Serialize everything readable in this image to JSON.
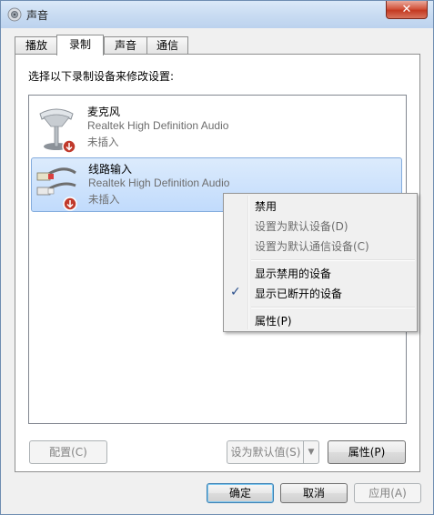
{
  "window": {
    "title": "声音",
    "close_icon": "close-icon"
  },
  "tabs": [
    {
      "label": "播放"
    },
    {
      "label": "录制"
    },
    {
      "label": "声音"
    },
    {
      "label": "通信"
    }
  ],
  "panel": {
    "instruction": "选择以下录制设备来修改设置:"
  },
  "devices": [
    {
      "name": "麦克风",
      "driver": "Realtek High Definition Audio",
      "status": "未插入",
      "icon": "microphone-icon"
    },
    {
      "name": "线路输入",
      "driver": "Realtek High Definition Audio",
      "status": "未插入",
      "icon": "line-in-icon"
    }
  ],
  "context_menu": {
    "items": [
      {
        "label": "禁用",
        "enabled": true
      },
      {
        "label": "设置为默认设备(D)",
        "enabled": false
      },
      {
        "label": "设置为默认通信设备(C)",
        "enabled": false
      },
      {
        "label": "显示禁用的设备",
        "enabled": true
      },
      {
        "label": "显示已断开的设备",
        "enabled": true,
        "checked": true
      },
      {
        "label": "属性(P)",
        "enabled": true
      }
    ]
  },
  "panel_buttons": {
    "configure": "配置(C)",
    "set_default": "设为默认值(S)",
    "properties": "属性(P)"
  },
  "dialog_buttons": {
    "ok": "确定",
    "cancel": "取消",
    "apply": "应用(A)"
  }
}
